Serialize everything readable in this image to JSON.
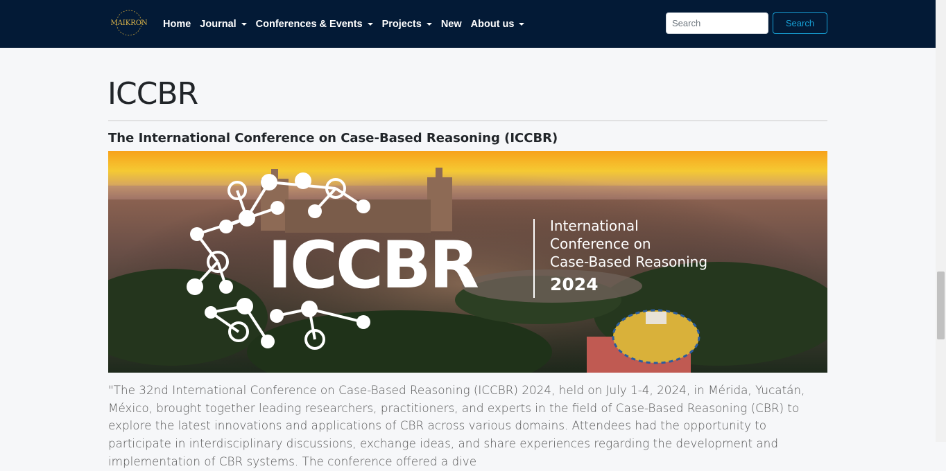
{
  "nav": {
    "logo_text": "MAIKRON",
    "items": [
      {
        "label": "Home",
        "dropdown": false
      },
      {
        "label": "Journal",
        "dropdown": true
      },
      {
        "label": "Conferences & Events",
        "dropdown": true
      },
      {
        "label": "Projects",
        "dropdown": true
      },
      {
        "label": "New",
        "dropdown": false
      },
      {
        "label": "About us",
        "dropdown": true
      }
    ],
    "search_placeholder": "Search",
    "search_button": "Search"
  },
  "page": {
    "title": "ICCBR",
    "subtitle": "The International Conference on Case-Based Reasoning (ICCBR)"
  },
  "banner": {
    "acronym": "ICCBR",
    "line1": "International",
    "line2": "Conference on",
    "line3": "Case-Based Reasoning",
    "year": "2024"
  },
  "body": {
    "paragraph": "\"The 32nd International Conference on Case-Based Reasoning (ICCBR) 2024, held on July 1-4, 2024, in Mérida, Yucatán, México, brought together leading researchers, practitioners, and experts in the field of Case-Based Reasoning (CBR) to explore the latest innovations and applications of CBR across various domains. Attendees had the opportunity to participate in interdisciplinary discussions, exchange ideas, and share experiences regarding the development and implementation of CBR systems. The conference offered a dive"
  },
  "colors": {
    "navbar_bg": "#031a36",
    "search_accent": "#17a2d8",
    "page_bg": "#f6f7f9"
  }
}
